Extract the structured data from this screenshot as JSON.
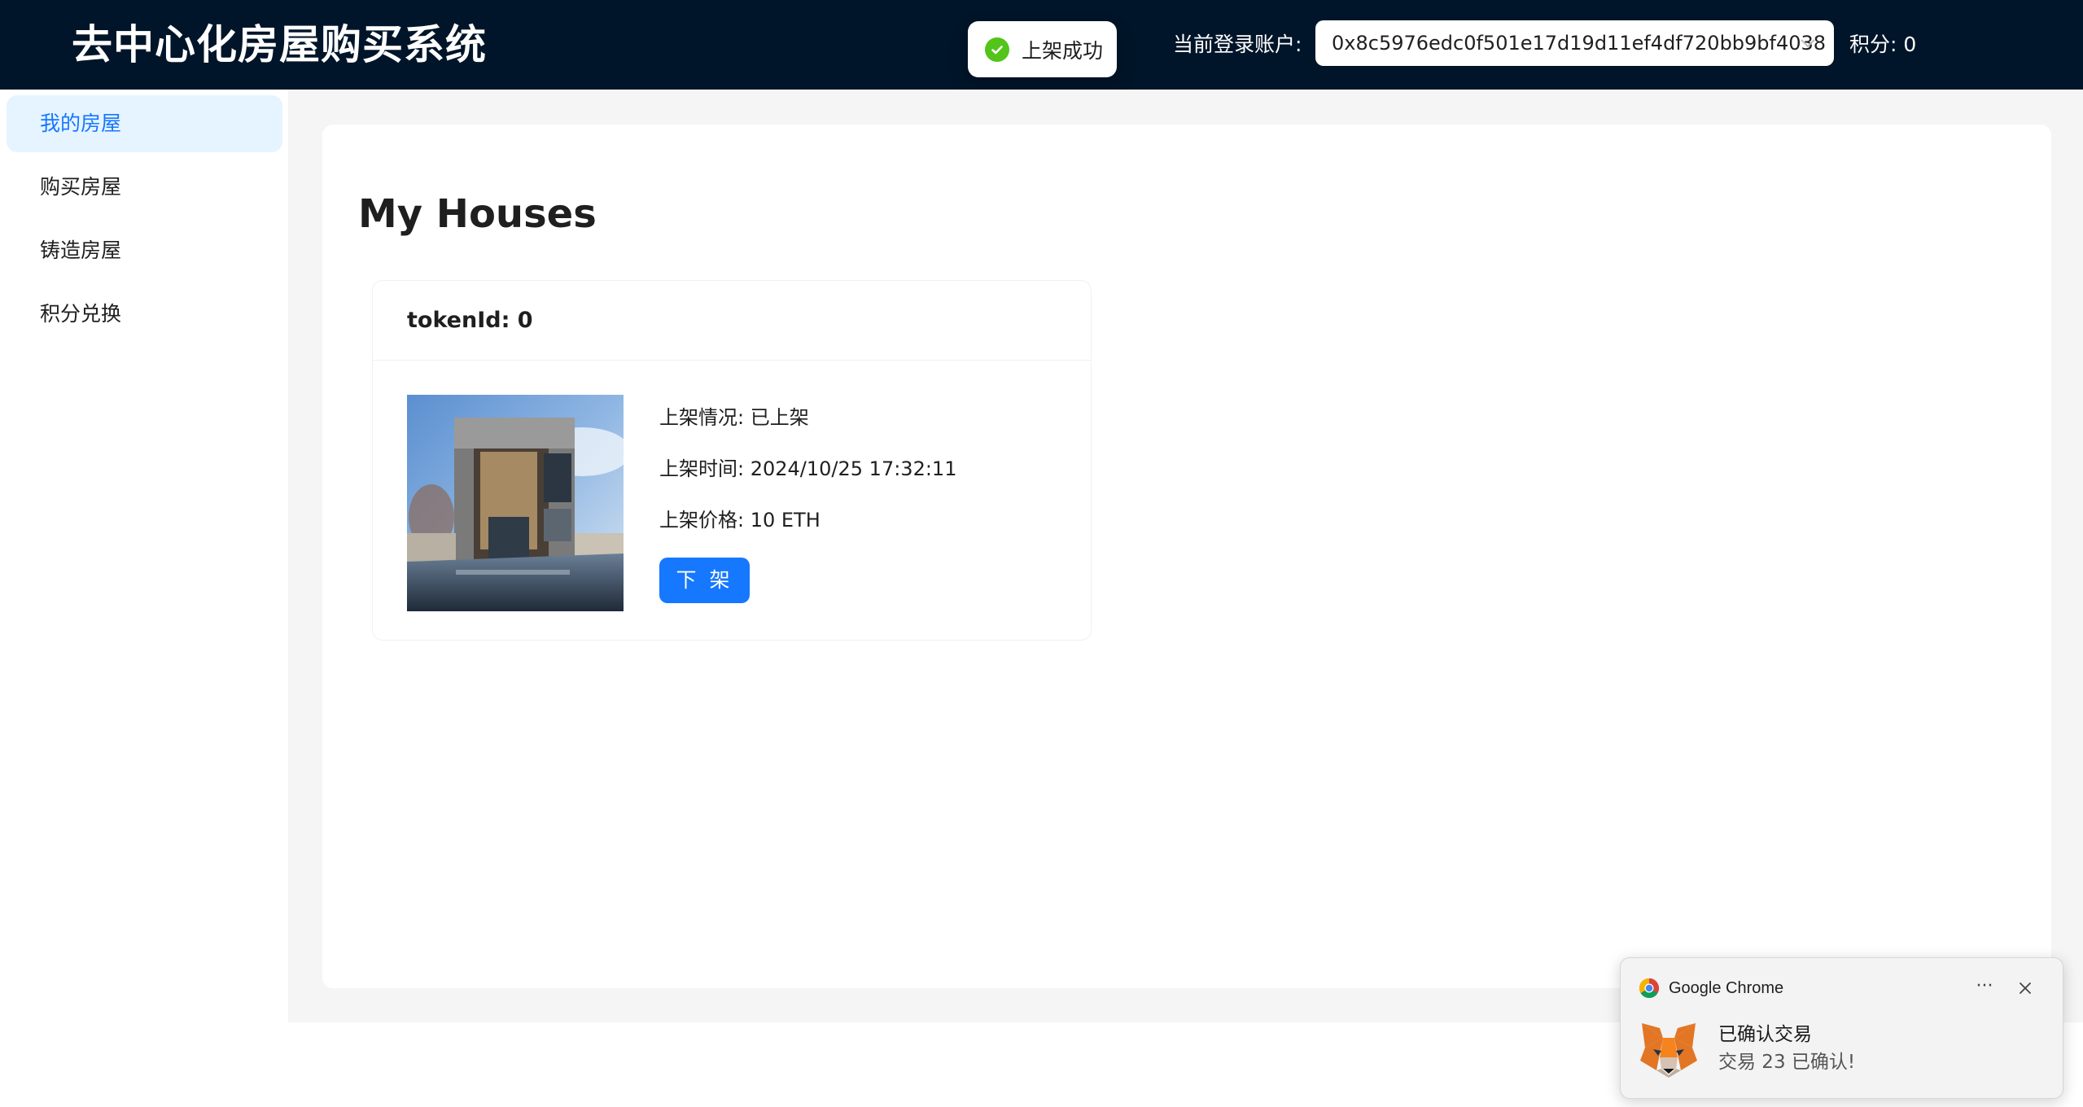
{
  "header": {
    "app_title": "去中心化房屋购买系统",
    "account_label": "当前登录账户:",
    "account_value": "0x8c5976edc0f501e17d19d11ef4df720bb9bf4038",
    "points_text": "积分: 0",
    "background_color": "#001529"
  },
  "toast": {
    "text": "上架成功",
    "status": "success",
    "icon": "check-circle-icon",
    "color": "#52c41a"
  },
  "sidebar": {
    "items": [
      {
        "label": "我的房屋",
        "active": true
      },
      {
        "label": "购买房屋",
        "active": false
      },
      {
        "label": "铸造房屋",
        "active": false
      },
      {
        "label": "积分兑换",
        "active": false
      }
    ],
    "active_color": "#1677ff",
    "active_background": "#e6f4ff"
  },
  "main": {
    "page_title": "My Houses",
    "cards": [
      {
        "title": "tokenId: 0",
        "image": "house-photo",
        "listing_status": "上架情况: 已上架",
        "listing_time": "上架时间: 2024/10/25 17:32:11",
        "listing_price": "上架价格: 10 ETH",
        "delist_button": "下 架"
      }
    ],
    "primary_color": "#1677ff"
  },
  "notification": {
    "app_name": "Google Chrome",
    "more_icon": "more-horizontal-icon",
    "close_icon": "close-icon",
    "app_icon": "metamask-fox-icon",
    "title": "已确认交易",
    "body": "交易 23 已确认!"
  }
}
